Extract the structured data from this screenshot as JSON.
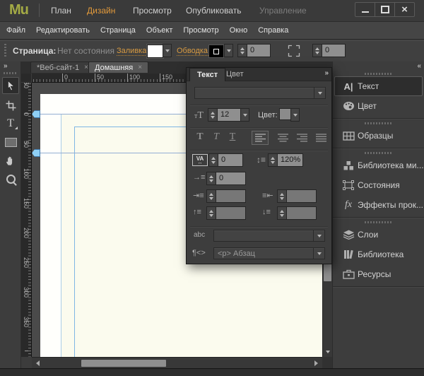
{
  "window": {
    "logo": "Mu"
  },
  "mode_tabs": [
    {
      "label": "План"
    },
    {
      "label": "Дизайн"
    },
    {
      "label": "Просмотр"
    },
    {
      "label": "Опубликовать"
    },
    {
      "label": "Управление"
    }
  ],
  "menu": [
    "Файл",
    "Редактировать",
    "Страница",
    "Объект",
    "Просмотр",
    "Окно",
    "Справка"
  ],
  "control_bar": {
    "page_label": "Страница:",
    "page_state": "Нет состояния",
    "fill_label": "Заливка:",
    "stroke_label": "Обводка:",
    "stroke_width": "0",
    "corner_radius": "0"
  },
  "document_tabs": [
    {
      "label": "*Веб-сайт-1",
      "close": "×"
    },
    {
      "label": "Домашняя",
      "close": "×"
    }
  ],
  "rulers": {
    "h": [
      "0",
      "50",
      "100",
      "150"
    ],
    "v": [
      "50",
      "0",
      "50",
      "100",
      "150",
      "200",
      "250",
      "300",
      "350"
    ]
  },
  "text_panel": {
    "tabs": [
      {
        "label": "Текст"
      },
      {
        "label": "Цвет"
      }
    ],
    "font_family": "",
    "font_size": "12",
    "color_label": "Цвет:",
    "tracking": "0",
    "leading": "120%",
    "first_line_indent": "0",
    "left_indent": "",
    "right_indent": "",
    "space_before": "",
    "space_after": "",
    "link_style": "",
    "paragraph_tag": "<p> Абзац"
  },
  "dock": {
    "groups": [
      {
        "items": [
          {
            "label": "Текст"
          },
          {
            "label": "Цвет"
          }
        ]
      },
      {
        "items": [
          {
            "label": "Образцы"
          }
        ]
      },
      {
        "items": [
          {
            "label": "Библиотека ми..."
          },
          {
            "label": "Состояния"
          },
          {
            "label": "Эффекты прок..."
          }
        ]
      },
      {
        "items": [
          {
            "label": "Слои"
          },
          {
            "label": "Библиотека"
          },
          {
            "label": "Ресурсы"
          }
        ]
      }
    ]
  },
  "colors": {
    "accent_orange": "#e39a3b",
    "logo_green": "#a4ab45",
    "guide_blue": "#8fb6e0",
    "page_cream": "#fbfbee"
  }
}
